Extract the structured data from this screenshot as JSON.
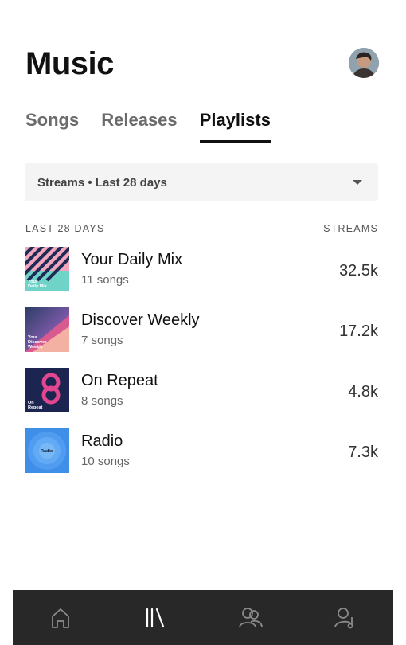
{
  "header": {
    "title": "Music"
  },
  "tabs": [
    {
      "label": "Songs"
    },
    {
      "label": "Releases"
    },
    {
      "label": "Playlists",
      "active": true
    }
  ],
  "filter": {
    "label": "Streams • Last 28 days"
  },
  "columns": {
    "left": "LAST 28 DAYS",
    "right": "STREAMS"
  },
  "playlists": [
    {
      "name": "Your Daily Mix",
      "count": "11 songs",
      "streams": "32.5k",
      "art_text": "Your Daily Mix"
    },
    {
      "name": "Discover Weekly",
      "count": "7 songs",
      "streams": "17.2k",
      "art_text": "Your Discover Weekly"
    },
    {
      "name": "On Repeat",
      "count": "8 songs",
      "streams": "4.8k",
      "art_text": "On Repeat"
    },
    {
      "name": "Radio",
      "count": "10 songs",
      "streams": "7.3k",
      "art_text": "Radio"
    }
  ],
  "nav": [
    {
      "icon": "home-icon"
    },
    {
      "icon": "library-icon",
      "active": true
    },
    {
      "icon": "audience-icon"
    },
    {
      "icon": "profile-icon"
    }
  ],
  "colors": {
    "active_nav": "#ffffff",
    "inactive_nav": "#8a8a8a",
    "navbar_bg": "#282828"
  }
}
